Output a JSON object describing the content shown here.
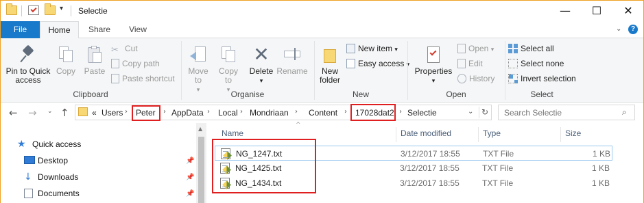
{
  "window": {
    "title": "Selectie",
    "minimize": "—",
    "maximize": "☐",
    "close": "✕"
  },
  "ribbon_tabs": [
    "File",
    "Home",
    "Share",
    "View"
  ],
  "ribbon": {
    "clipboard": {
      "pin_label": "Pin to Quick access",
      "copy_label": "Copy",
      "paste_label": "Paste",
      "cut_label": "Cut",
      "copy_path_label": "Copy path",
      "paste_shortcut_label": "Paste shortcut",
      "group_label": "Clipboard"
    },
    "organise": {
      "move_to_label": "Move to",
      "copy_to_label": "Copy to",
      "delete_label": "Delete",
      "rename_label": "Rename",
      "group_label": "Organise"
    },
    "new": {
      "new_folder_label": "New folder",
      "new_item_label": "New item",
      "easy_access_label": "Easy access",
      "group_label": "New"
    },
    "open": {
      "properties_label": "Properties",
      "open_label": "Open",
      "edit_label": "Edit",
      "history_label": "History",
      "group_label": "Open"
    },
    "select": {
      "select_all_label": "Select all",
      "select_none_label": "Select none",
      "invert_selection_label": "Invert selection",
      "group_label": "Select"
    }
  },
  "address": {
    "overflow": "«",
    "crumbs": [
      "Users",
      "Peter",
      "AppData",
      "Local",
      "Mondriaan",
      "Content",
      "17028dat2",
      "Selectie"
    ]
  },
  "search": {
    "placeholder": "Search Selectie"
  },
  "nav_pane": {
    "items": [
      "Quick access",
      "Desktop",
      "Downloads",
      "Documents"
    ]
  },
  "columns": [
    "Name",
    "Date modified",
    "Type",
    "Size"
  ],
  "files": [
    {
      "name": "NG_1247.txt",
      "date": "3/12/2017 18:55",
      "type": "TXT File",
      "size": "1 KB"
    },
    {
      "name": "NG_1425.txt",
      "date": "3/12/2017 18:55",
      "type": "TXT File",
      "size": "1 KB"
    },
    {
      "name": "NG_1434.txt",
      "date": "3/12/2017 18:55",
      "type": "TXT File",
      "size": "1 KB"
    }
  ],
  "colors": {
    "file_tab": "#1979ca",
    "highlight": "#e02020",
    "selection_border": "#99c9ef"
  }
}
